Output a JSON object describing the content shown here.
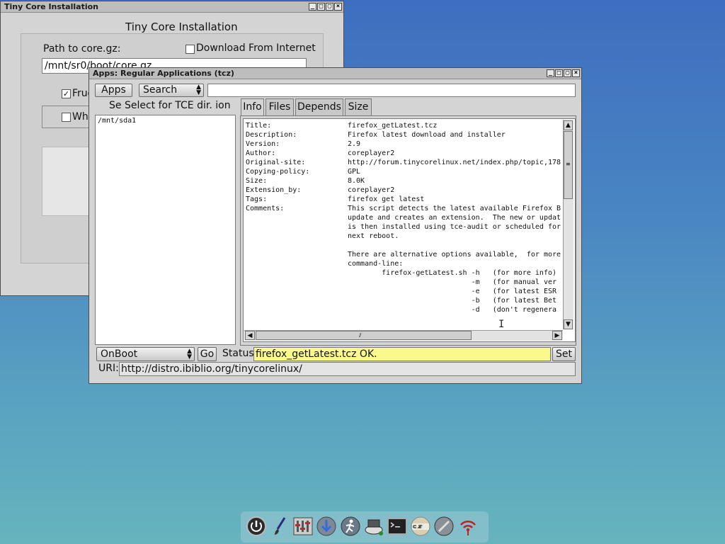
{
  "installer": {
    "window_title": "Tiny Core Installation",
    "heading": "Tiny Core Installation",
    "path_label": "Path to core.gz:",
    "download_label": "Download From Internet",
    "path_value": "/mnt/sr0/boot/core.gz",
    "frugal_label": "Frug",
    "whole_label": "Wh"
  },
  "apps": {
    "window_title": "Apps: Regular Applications (tcz)",
    "apps_button": "Apps",
    "search_select": "Search",
    "search_value": "",
    "select_tce_label": "Se Select for TCE dir. ion",
    "dir_items": [
      "/mnt/sda1"
    ],
    "tabs": [
      "Info",
      "Files",
      "Depends",
      "Size"
    ],
    "info": [
      {
        "k": "Title:",
        "v": "firefox_getLatest.tcz"
      },
      {
        "k": "Description:",
        "v": "Firefox latest download and installer"
      },
      {
        "k": "Version:",
        "v": "2.9"
      },
      {
        "k": "Author:",
        "v": "coreplayer2"
      },
      {
        "k": "Original-site:",
        "v": "http://forum.tinycorelinux.net/index.php/topic,178"
      },
      {
        "k": "Copying-policy:",
        "v": "GPL"
      },
      {
        "k": "Size:",
        "v": "8.0K"
      },
      {
        "k": "Extension_by:",
        "v": "coreplayer2"
      },
      {
        "k": "Tags:",
        "v": "firefox get latest"
      },
      {
        "k": "Comments:",
        "v": "This script detects the latest available Firefox B"
      },
      {
        "k": "",
        "v": "update and creates an extension.  The new or updat"
      },
      {
        "k": "",
        "v": "is then installed using tce-audit or scheduled for"
      },
      {
        "k": "",
        "v": "next reboot."
      },
      {
        "k": "",
        "v": ""
      },
      {
        "k": "",
        "v": "There are alternative options available,  for more"
      },
      {
        "k": "",
        "v": "command-line:"
      },
      {
        "k": "",
        "v": "        firefox-getLatest.sh -h   (for more info)"
      },
      {
        "k": "",
        "v": "                             -m   (for manual ver"
      },
      {
        "k": "",
        "v": "                             -e   (for latest ESR"
      },
      {
        "k": "",
        "v": "                             -b   (for latest Bet"
      },
      {
        "k": "",
        "v": "                             -d   (don't regenera"
      }
    ],
    "onboot_select": "OnBoot",
    "go_button": "Go",
    "status_label": "Status",
    "status_value": "firefox_getLatest.tcz OK.",
    "set_button": "Set",
    "uri_label": "URI:",
    "uri_value": "http://distro.ibiblio.org/tinycorelinux/"
  },
  "window_buttons": [
    "_",
    "□",
    "▢",
    "×"
  ],
  "dock": [
    {
      "name": "power-icon"
    },
    {
      "name": "paintbrush-icon"
    },
    {
      "name": "control-panel-icon"
    },
    {
      "name": "apps-download-icon"
    },
    {
      "name": "run-icon"
    },
    {
      "name": "mount-tool-icon"
    },
    {
      "name": "terminal-icon"
    },
    {
      "name": "ezremaster-icon"
    },
    {
      "name": "installer-icon"
    },
    {
      "name": "wifi-icon"
    }
  ],
  "colors": {
    "status_bg": "#fafa8c",
    "titlebar": "#bdbdbd"
  }
}
